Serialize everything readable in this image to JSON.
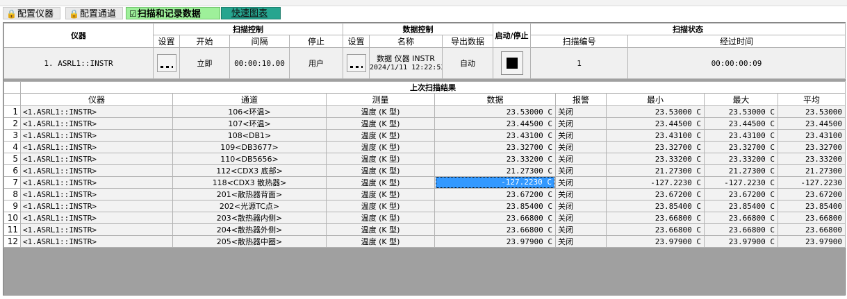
{
  "tabs": [
    {
      "label": "配置仪器",
      "icon": "lock-icon"
    },
    {
      "label": "配置通道",
      "icon": "lock-icon"
    },
    {
      "label": "扫描和记录数据",
      "icon": "check-circle-icon"
    },
    {
      "label": "快速图表"
    }
  ],
  "control": {
    "instrument_header": "仪器",
    "scan_control_header": "扫描控制",
    "data_control_header": "数据控制",
    "start_stop_header": "启动/停止",
    "scan_status_header": "扫描状态",
    "sub": {
      "setup": "设置",
      "start": "开始",
      "interval": "间隔",
      "stop": "停止",
      "data_setup": "设置",
      "name": "名称",
      "export": "导出数据",
      "scan_number": "扫描编号",
      "elapsed": "经过时间"
    },
    "values": {
      "instrument": "1. ASRL1::INSTR",
      "start": "立即",
      "interval": "00:00:10.00",
      "stop": "用户",
      "data_name": "数据 仪器 INSTR",
      "data_date": "2024/1/11 12:22:53",
      "export": "自动",
      "scan_number": "1",
      "elapsed": "00:00:00:09"
    }
  },
  "results": {
    "title": "上次扫描结果",
    "columns": [
      "仪器",
      "通道",
      "测量",
      "数据",
      "报警",
      "最小",
      "最大",
      "平均"
    ],
    "rows": [
      {
        "n": "1",
        "inst": "<1.ASRL1::INSTR>",
        "ch": "106<环温>",
        "meas": "温度 (K 型)",
        "data": "23.53000 C",
        "alarm": "关闭",
        "min": "23.53000 C",
        "max": "23.53000 C",
        "avg": "23.53000"
      },
      {
        "n": "2",
        "inst": "<1.ASRL1::INSTR>",
        "ch": "107<环温>",
        "meas": "温度 (K 型)",
        "data": "23.44500 C",
        "alarm": "关闭",
        "min": "23.44500 C",
        "max": "23.44500 C",
        "avg": "23.44500"
      },
      {
        "n": "3",
        "inst": "<1.ASRL1::INSTR>",
        "ch": "108<DB1>",
        "meas": "温度 (K 型)",
        "data": "23.43100 C",
        "alarm": "关闭",
        "min": "23.43100 C",
        "max": "23.43100 C",
        "avg": "23.43100"
      },
      {
        "n": "4",
        "inst": "<1.ASRL1::INSTR>",
        "ch": "109<DB3677>",
        "meas": "温度 (K 型)",
        "data": "23.32700 C",
        "alarm": "关闭",
        "min": "23.32700 C",
        "max": "23.32700 C",
        "avg": "23.32700"
      },
      {
        "n": "5",
        "inst": "<1.ASRL1::INSTR>",
        "ch": "110<DB5656>",
        "meas": "温度 (K 型)",
        "data": "23.33200 C",
        "alarm": "关闭",
        "min": "23.33200 C",
        "max": "23.33200 C",
        "avg": "23.33200"
      },
      {
        "n": "6",
        "inst": "<1.ASRL1::INSTR>",
        "ch": "112<CDX3 底部>",
        "meas": "温度 (K 型)",
        "data": "21.27300 C",
        "alarm": "关闭",
        "min": "21.27300 C",
        "max": "21.27300 C",
        "avg": "21.27300"
      },
      {
        "n": "7",
        "inst": "<1.ASRL1::INSTR>",
        "ch": "118<CDX3 散热器>",
        "meas": "温度 (K 型)",
        "data": "-127.2230 C",
        "alarm": "关闭",
        "min": "-127.2230 C",
        "max": "-127.2230 C",
        "avg": "-127.2230"
      },
      {
        "n": "8",
        "inst": "<1.ASRL1::INSTR>",
        "ch": "201<散热器背面>",
        "meas": "温度 (K 型)",
        "data": "23.67200 C",
        "alarm": "关闭",
        "min": "23.67200 C",
        "max": "23.67200 C",
        "avg": "23.67200"
      },
      {
        "n": "9",
        "inst": "<1.ASRL1::INSTR>",
        "ch": "202<光源TC点>",
        "meas": "温度 (K 型)",
        "data": "23.85400 C",
        "alarm": "关闭",
        "min": "23.85400 C",
        "max": "23.85400 C",
        "avg": "23.85400"
      },
      {
        "n": "10",
        "inst": "<1.ASRL1::INSTR>",
        "ch": "203<散热器内侧>",
        "meas": "温度 (K 型)",
        "data": "23.66800 C",
        "alarm": "关闭",
        "min": "23.66800 C",
        "max": "23.66800 C",
        "avg": "23.66800"
      },
      {
        "n": "11",
        "inst": "<1.ASRL1::INSTR>",
        "ch": "204<散热器外侧>",
        "meas": "温度 (K 型)",
        "data": "23.66800 C",
        "alarm": "关闭",
        "min": "23.66800 C",
        "max": "23.66800 C",
        "avg": "23.66800"
      },
      {
        "n": "12",
        "inst": "<1.ASRL1::INSTR>",
        "ch": "205<散热器中圈>",
        "meas": "温度 (K 型)",
        "data": "23.97900 C",
        "alarm": "关闭",
        "min": "23.97900 C",
        "max": "23.97900 C",
        "avg": "23.97900"
      }
    ],
    "selected_row": "7"
  }
}
